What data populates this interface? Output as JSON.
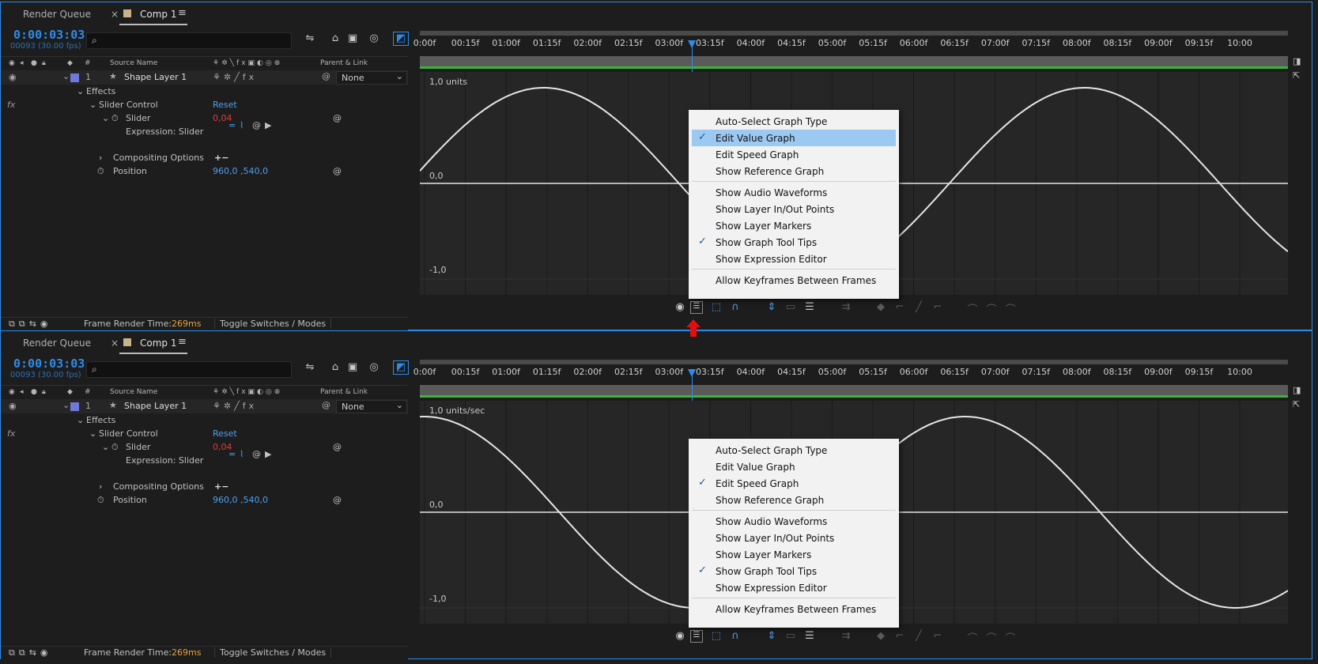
{
  "panels": [
    {
      "tabs": {
        "render_queue": "Render Queue",
        "close": "×",
        "comp": "Comp 1",
        "menu": "≡"
      },
      "timecode": "0:00:03:03",
      "fps": "00093 (30.00 fps)",
      "columns": {
        "num": "#",
        "source_name": "Source Name",
        "parent": "Parent & Link"
      },
      "layer": {
        "index": "1",
        "name": "Shape Layer 1",
        "parent": "None"
      },
      "rows": {
        "effects": "Effects",
        "slider_control": "Slider Control",
        "reset": "Reset",
        "slider": "Slider",
        "slider_value": "0,04",
        "expression": "Expression: Slider",
        "compositing": "Compositing Options",
        "position": "Position",
        "position_value": "960,0 ,540,0"
      },
      "footer": {
        "frt_label": "Frame Render Time:",
        "frt_value": "269ms",
        "toggle": "Toggle Switches / Modes"
      },
      "ruler": [
        "0:00f",
        "00:15f",
        "01:00f",
        "01:15f",
        "02:00f",
        "02:15f",
        "03:00f",
        "03:15f",
        "04:00f",
        "04:15f",
        "05:00f",
        "05:15f",
        "06:00f",
        "06:15f",
        "07:00f",
        "07:15f",
        "08:00f",
        "08:15f",
        "09:00f",
        "09:15f",
        "10:00"
      ],
      "graph": {
        "top_label": "1,0 units",
        "mid_label": "0,0",
        "bottom_label": "-1,0",
        "curve": "value"
      },
      "menu": [
        {
          "label": "Auto-Select Graph Type",
          "checked": false
        },
        {
          "label": "Edit Value Graph",
          "checked": true,
          "highlight": true
        },
        {
          "label": "Edit Speed Graph",
          "checked": false
        },
        {
          "label": "Show Reference Graph",
          "checked": false
        },
        {
          "label": "Show Audio Waveforms",
          "checked": false
        },
        {
          "label": "Show Layer In/Out Points",
          "checked": false
        },
        {
          "label": "Show Layer Markers",
          "checked": false
        },
        {
          "label": "Show Graph Tool Tips",
          "checked": true
        },
        {
          "label": "Show Expression Editor",
          "checked": false
        },
        {
          "label": "Allow Keyframes Between Frames",
          "checked": false
        }
      ]
    },
    {
      "tabs": {
        "render_queue": "Render Queue",
        "close": "×",
        "comp": "Comp 1",
        "menu": "≡"
      },
      "timecode": "0:00:03:03",
      "fps": "00093 (30.00 fps)",
      "columns": {
        "num": "#",
        "source_name": "Source Name",
        "parent": "Parent & Link"
      },
      "layer": {
        "index": "1",
        "name": "Shape Layer 1",
        "parent": "None"
      },
      "rows": {
        "effects": "Effects",
        "slider_control": "Slider Control",
        "reset": "Reset",
        "slider": "Slider",
        "slider_value": "0,04",
        "expression": "Expression: Slider",
        "compositing": "Compositing Options",
        "position": "Position",
        "position_value": "960,0 ,540,0"
      },
      "footer": {
        "frt_label": "Frame Render Time:",
        "frt_value": "269ms",
        "toggle": "Toggle Switches / Modes"
      },
      "ruler": [
        "0:00f",
        "00:15f",
        "01:00f",
        "01:15f",
        "02:00f",
        "02:15f",
        "03:00f",
        "03:15f",
        "04:00f",
        "04:15f",
        "05:00f",
        "05:15f",
        "06:00f",
        "06:15f",
        "07:00f",
        "07:15f",
        "08:00f",
        "08:15f",
        "09:00f",
        "09:15f",
        "10:00"
      ],
      "graph": {
        "top_label": "1,0 units/sec",
        "mid_label": "0,0",
        "bottom_label": "-1,0",
        "curve": "speed"
      },
      "menu": [
        {
          "label": "Auto-Select Graph Type",
          "checked": false
        },
        {
          "label": "Edit Value Graph",
          "checked": false
        },
        {
          "label": "Edit Speed Graph",
          "checked": true
        },
        {
          "label": "Show Reference Graph",
          "checked": false
        },
        {
          "label": "Show Audio Waveforms",
          "checked": false
        },
        {
          "label": "Show Layer In/Out Points",
          "checked": false
        },
        {
          "label": "Show Layer Markers",
          "checked": false
        },
        {
          "label": "Show Graph Tool Tips",
          "checked": true
        },
        {
          "label": "Show Expression Editor",
          "checked": false
        },
        {
          "label": "Allow Keyframes Between Frames",
          "checked": false
        }
      ]
    }
  ],
  "colors": {
    "accent": "#2d8ceb",
    "value_red": "#e23b3b",
    "highlight": "#9cc9f2",
    "arrow": "#e01010"
  },
  "icons": [
    "search-icon",
    "eye-icon",
    "lock-icon",
    "label-icon",
    "star-icon",
    "stopwatch-icon",
    "spiral-icon",
    "graph-options-icon",
    "snap-icon",
    "fit-icon"
  ]
}
